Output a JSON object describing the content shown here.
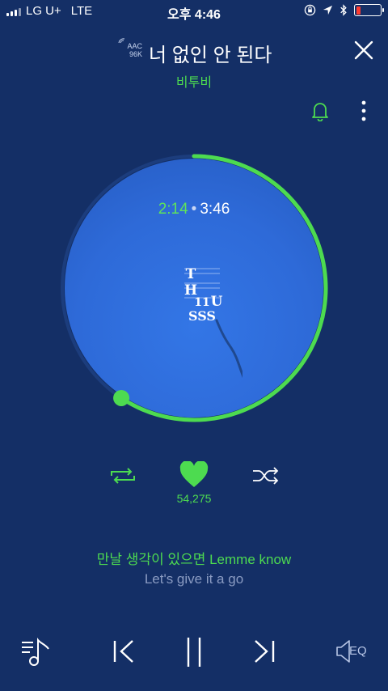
{
  "status_bar": {
    "carrier": "LG U+",
    "network": "LTE",
    "time": "오후 4:46",
    "battery_color": "#ff3b30"
  },
  "header": {
    "quality_line1": "AAC",
    "quality_line2": "96K",
    "title": "너 없인 안 된다",
    "artist": "비투비",
    "close_icon": "close-icon"
  },
  "player": {
    "current_time": "2:14",
    "total_time": "3:46",
    "progress": 0.593,
    "accent": "#4ddb50"
  },
  "album": {
    "art_letters": [
      "T",
      "H",
      "11",
      "U",
      "SSS"
    ]
  },
  "actions": {
    "like_count": "54,275"
  },
  "lyrics": {
    "current": "만날 생각이 있으면 Lemme know",
    "next": "Let's give it a go"
  },
  "bottom_controls": {
    "eq_label": "EQ"
  }
}
